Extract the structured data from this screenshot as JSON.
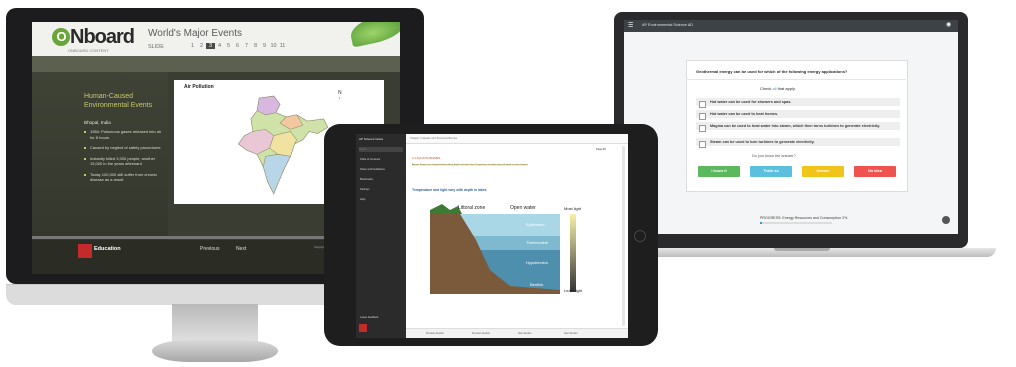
{
  "monitor": {
    "logo": "ONboard",
    "logo_tag": "ONBOARD CONTENT",
    "title": "World's Major Events",
    "slide_label": "SLIDE",
    "slides": [
      "1",
      "2",
      "3",
      "4",
      "5",
      "6",
      "7",
      "8",
      "9",
      "10",
      "11"
    ],
    "current_slide": "3",
    "heading": "Human-Caused Environmental Events",
    "location": "Bhopal, India",
    "bullets": [
      "1984: Poisonous gases released into air for 8 hours",
      "Caused by neglect of safety procedures",
      "Instantly killed 3,000 people; another 15,000 in the years afterward",
      "Today 100,000 still suffer from chronic disease as a result"
    ],
    "card_title": "Air Pollution",
    "compass_label": "N",
    "footer_brand": "Education",
    "prev_label": "Previous",
    "next_label": "Next",
    "copyright": "Copyright"
  },
  "laptop": {
    "title": "AP Environmental Science AD",
    "question": "Geothermal energy can be used for which of the following energy applications?",
    "check_prefix": "Check",
    "check_highlight": "all",
    "check_suffix": "that apply.",
    "options": [
      "Hot water can be used for showers and spas.",
      "Hot water can be used to heat homes.",
      "Magma can be used to heat water into steam, which then turns turbines to generate electricity.",
      "Steam can be used to turn turbines to generate electricity."
    ],
    "know_prompt": "Do you know the answer?",
    "buttons": [
      {
        "label": "I know it",
        "color": "#5cb85c"
      },
      {
        "label": "Think so",
        "color": "#5bc0de"
      },
      {
        "label": "Unsure",
        "color": "#f0c419"
      },
      {
        "label": "No idea",
        "color": "#ef5350"
      }
    ],
    "progress_label": "PROGRESS: Energy Resources and Consumption",
    "progress_value": "2%",
    "progress_fraction": 0.02
  },
  "tablet": {
    "sidebar_title": "AP Science Notes",
    "search_placeholder": "Search",
    "nav": [
      "Table of Contents",
      "Notes and Guidelines",
      "Bookmarks",
      "Settings",
      "Help"
    ],
    "sidebar_footer": "Leave feedback",
    "breadcrumb": "Chapter 3 Aquatic and Terrestrial Biomes",
    "page_label": "Page",
    "page_number": "99",
    "section": "3.1 AQUATIC BIOMES",
    "intro": "Aquatic biomes are categorized by salinity, depth and water flow. Temperature and light vary with depth in these biomes.",
    "subheading": "Temperature and light vary with depth in lakes",
    "fig_labels": {
      "littoral": "Littoral zone",
      "open_water": "Open water",
      "most_light": "Most light",
      "least_light": "Least light",
      "epilimnion": "Epilimnion",
      "thermocline": "Thermocline",
      "hypolimnion": "Hypolimnion",
      "benthic": "Benthic"
    },
    "bottom_items": [
      "Previous Section",
      "Previous Section",
      "Next Section",
      "Next Section"
    ]
  }
}
